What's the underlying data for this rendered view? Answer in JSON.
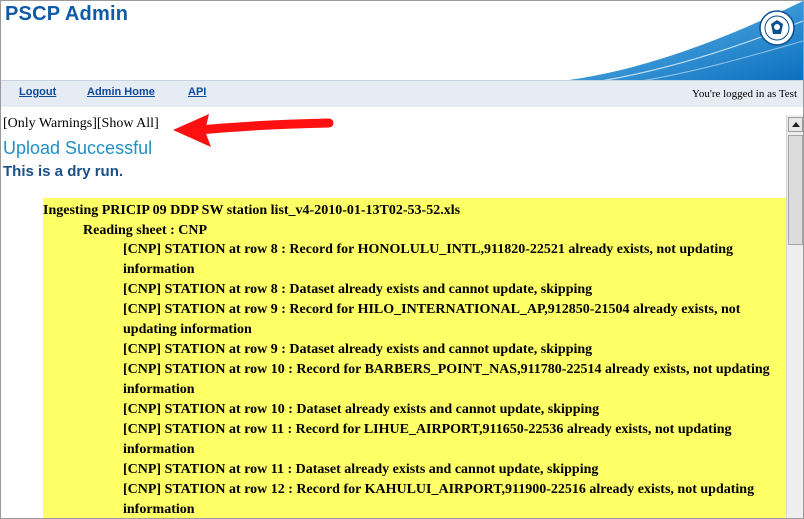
{
  "header": {
    "title": "PSCP Admin",
    "seal_icon": "agency-seal-icon",
    "brand_color": "#0f5aa8",
    "swoosh_color": "#1a8ad4"
  },
  "nav": {
    "logout": "Logout",
    "admin_home": "Admin Home",
    "api": "API",
    "logged_in_text": "You're logged in as Test"
  },
  "content": {
    "filter_only_warnings": "[Only Warnings]",
    "filter_show_all": "[Show All]",
    "upload_message": "Upload Successful",
    "dry_run_message": "This is a dry run.",
    "log": {
      "title": "Ingesting PRICIP 09 DDP SW station list_v4-2010-01-13T02-53-52.xls",
      "sheet": "Reading sheet : CNP",
      "lines": [
        "[CNP] STATION at row 8 : Record for HONOLULU_INTL,911820-22521 already exists, not updating information",
        "[CNP] STATION at row 8 : Dataset already exists and cannot update, skipping",
        "[CNP] STATION at row 9 : Record for HILO_INTERNATIONAL_AP,912850-21504 already exists, not updating information",
        "[CNP] STATION at row 9 : Dataset already exists and cannot update, skipping",
        "[CNP] STATION at row 10 : Record for BARBERS_POINT_NAS,911780-22514 already exists, not updating information",
        "[CNP] STATION at row 10 : Dataset already exists and cannot update, skipping",
        "[CNP] STATION at row 11 : Record for LIHUE_AIRPORT,911650-22536 already exists, not updating information",
        "[CNP] STATION at row 11 : Dataset already exists and cannot update, skipping",
        "[CNP] STATION at row 12 : Record for KAHULUI_AIRPORT,911900-22516 already exists, not updating information"
      ],
      "highlight_color": "#ffff66"
    },
    "annotation_color": "#ff1010"
  },
  "scrollbar": {
    "up_icon": "scroll-up-arrow-icon"
  }
}
